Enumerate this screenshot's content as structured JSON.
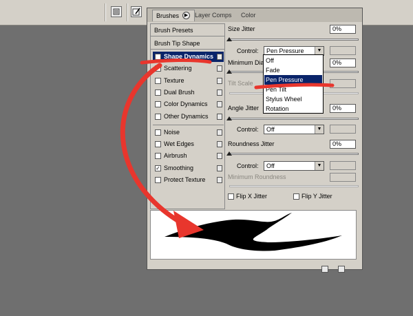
{
  "tabs": [
    {
      "label": "Brushes",
      "active": true
    },
    {
      "label": "Layer Comps",
      "active": false
    },
    {
      "label": "Color",
      "active": false
    }
  ],
  "tab_menu_arrow": "▶",
  "left_panel": {
    "headers": [
      "Brush Presets",
      "Brush Tip Shape"
    ],
    "items": [
      {
        "label": "Shape Dynamics",
        "checked": true,
        "selected": true,
        "lock": true
      },
      {
        "label": "Scattering",
        "checked": false,
        "selected": false,
        "lock": true
      },
      {
        "label": "Texture",
        "checked": false,
        "selected": false,
        "lock": true
      },
      {
        "label": "Dual Brush",
        "checked": false,
        "selected": false,
        "lock": true
      },
      {
        "label": "Color Dynamics",
        "checked": false,
        "selected": false,
        "lock": true
      },
      {
        "label": "Other Dynamics",
        "checked": false,
        "selected": false,
        "lock": true
      },
      {
        "label": "Noise",
        "checked": false,
        "selected": false,
        "lock": true
      },
      {
        "label": "Wet Edges",
        "checked": false,
        "selected": false,
        "lock": true
      },
      {
        "label": "Airbrush",
        "checked": false,
        "selected": false,
        "lock": true
      },
      {
        "label": "Smoothing",
        "checked": true,
        "selected": false,
        "lock": true
      },
      {
        "label": "Protect Texture",
        "checked": false,
        "selected": false,
        "lock": true
      }
    ]
  },
  "settings": {
    "size_jitter": {
      "label": "Size Jitter",
      "value": "0%"
    },
    "control_label": "Control:",
    "size_control": "Pen Pressure",
    "minimum_diameter": {
      "label": "Minimum Dia",
      "value": "0%"
    },
    "tilt_scale": {
      "label": "Tilt Scale"
    },
    "angle_jitter": {
      "label": "Angle Jitter",
      "value": "0%"
    },
    "angle_control": "Off",
    "roundness_jitter": {
      "label": "Roundness Jitter",
      "value": "0%"
    },
    "roundness_control": "Off",
    "minimum_roundness": {
      "label": "Minimum Roundness"
    },
    "flip_x": {
      "label": "Flip X Jitter",
      "checked": false
    },
    "flip_y": {
      "label": "Flip Y Jitter",
      "checked": false
    }
  },
  "dropdown": {
    "options": [
      "Off",
      "Fade",
      "Pen Pressure",
      "Pen Tilt",
      "Stylus Wheel",
      "Rotation"
    ],
    "selected": "Pen Pressure"
  },
  "checkmark_glyph": "✓",
  "dropdown_arrow_glyph": "▼",
  "colors": {
    "selection": "#0a246a",
    "annotation": "#e8362d",
    "panel": "#d4d0c8",
    "desktop": "#6f6f6f"
  }
}
